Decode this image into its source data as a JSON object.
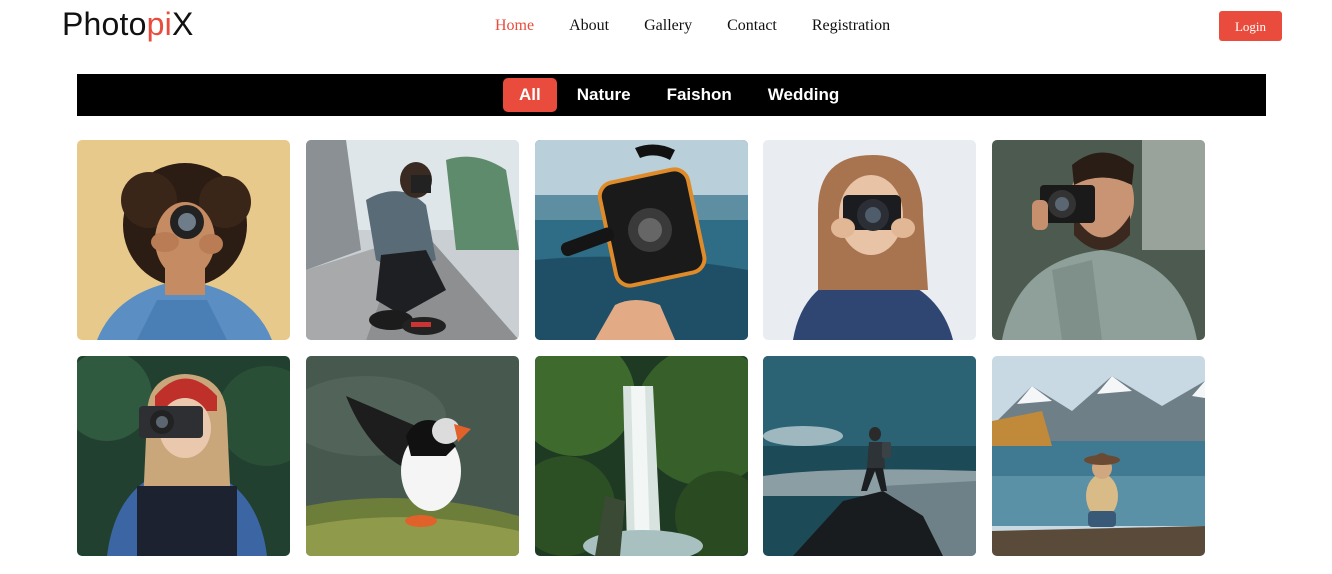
{
  "brand": {
    "prefix": "Photo",
    "accent": "pi",
    "suffix": "X",
    "accent_color": "#e94b3c"
  },
  "nav": {
    "items": [
      {
        "label": "Home",
        "active": true
      },
      {
        "label": "About"
      },
      {
        "label": "Gallery"
      },
      {
        "label": "Contact"
      },
      {
        "label": "Registration"
      }
    ],
    "login_label": "Login"
  },
  "filters": [
    {
      "label": "All",
      "active": true
    },
    {
      "label": "Nature"
    },
    {
      "label": "Faishon"
    },
    {
      "label": "Wedding"
    }
  ],
  "gallery": [
    {
      "name": "photo-woman-curly-hair-lens",
      "subject": "woman with curly hair looking through lens"
    },
    {
      "name": "photo-man-crouching-street",
      "subject": "man crouching on road with camera"
    },
    {
      "name": "photo-underwater-camera-housing",
      "subject": "underwater camera housing over sea"
    },
    {
      "name": "photo-woman-camera-blue-jacket",
      "subject": "woman holding camera"
    },
    {
      "name": "photo-bearded-man-camera",
      "subject": "bearded man with camera"
    },
    {
      "name": "photo-woman-red-beanie-camera",
      "subject": "woman in red beanie with camera"
    },
    {
      "name": "photo-puffin",
      "subject": "puffin spreading wings"
    },
    {
      "name": "photo-waterfall-forest",
      "subject": "waterfall in green forest"
    },
    {
      "name": "photo-hiker-on-rock",
      "subject": "hiker standing on rock"
    },
    {
      "name": "photo-woman-lake-mountains",
      "subject": "woman sitting by mountain lake"
    }
  ]
}
